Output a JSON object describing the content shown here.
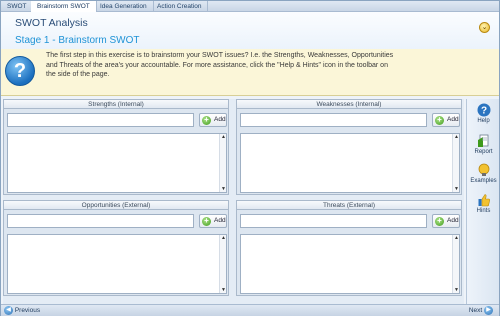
{
  "tabs": [
    {
      "label": "SWOT",
      "active": false
    },
    {
      "label": "Brainstorm SWOT",
      "active": true
    },
    {
      "label": "Idea Generation",
      "active": false
    },
    {
      "label": "Action Creation",
      "active": false
    }
  ],
  "header": {
    "app_title": "SWOT Analysis",
    "stage_title": "Stage 1 - Brainstorm SWOT",
    "collapse_glyph": "⌄"
  },
  "intro": {
    "help_glyph": "?",
    "lines": [
      "The first step in this exercise is to brainstorm your SWOT issues? I.e. the Strengths, Weaknesses, Opportunities",
      "and Threats of the area's your accountable.   For more assistance, click the \"Help & Hints\" icon in the toolbar on",
      "the side of the page."
    ]
  },
  "panels": [
    {
      "title": "Strengths (Internal)",
      "input_value": "",
      "add_label": "Add",
      "items": []
    },
    {
      "title": "Weaknesses (Internal)",
      "input_value": "",
      "add_label": "Add",
      "items": []
    },
    {
      "title": "Opportunities (External)",
      "input_value": "",
      "add_label": "Add",
      "items": []
    },
    {
      "title": "Threats (External)",
      "input_value": "",
      "add_label": "Add",
      "items": []
    }
  ],
  "toolbar": {
    "items": [
      {
        "label": "Help",
        "icon": "help-icon"
      },
      {
        "label": "Report",
        "icon": "report-icon"
      },
      {
        "label": "Examples",
        "icon": "examples-icon"
      },
      {
        "label": "Hints",
        "icon": "hints-icon"
      }
    ]
  },
  "footer": {
    "previous_label": "Previous",
    "next_label": "Next"
  },
  "colors": {
    "stage_title": "#1f93d6",
    "app_title": "#2a4d78",
    "intro_background": "#fbf6d8",
    "accent_blue": "#1b6fbf",
    "add_green": "#3f9a1c"
  }
}
